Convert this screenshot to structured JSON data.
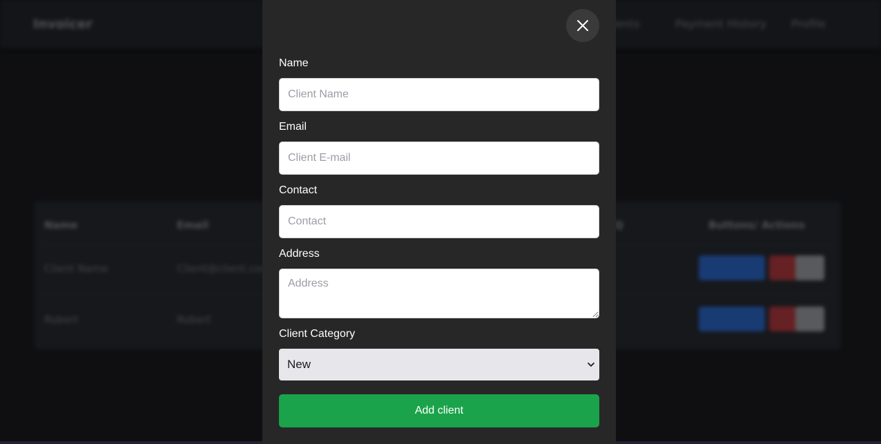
{
  "background": {
    "brand": "Invoicer",
    "nav_links": [
      "Clients",
      "Payment History",
      "Profile"
    ],
    "table": {
      "headers": [
        "Name",
        "Email",
        "Q",
        "Buttons/ Actions"
      ],
      "rows": [
        {
          "name": "Client Name",
          "email": "Client@client.com"
        },
        {
          "name": "Robert",
          "email": "Robert"
        }
      ]
    }
  },
  "modal": {
    "fields": {
      "name": {
        "label": "Name",
        "placeholder": "Client Name"
      },
      "email": {
        "label": "Email",
        "placeholder": "Client E-mail"
      },
      "contact": {
        "label": "Contact",
        "placeholder": "Contact"
      },
      "address": {
        "label": "Address",
        "placeholder": "Address"
      }
    },
    "category": {
      "label": "Client Category",
      "selected": "New"
    },
    "submit_label": "Add client"
  },
  "colors": {
    "modal_bg": "#272727",
    "submit": "#1aa34a",
    "page_bg": "#1a1b1e"
  },
  "icons": {
    "close": "close-icon",
    "chevron": "chevron-down-icon"
  }
}
